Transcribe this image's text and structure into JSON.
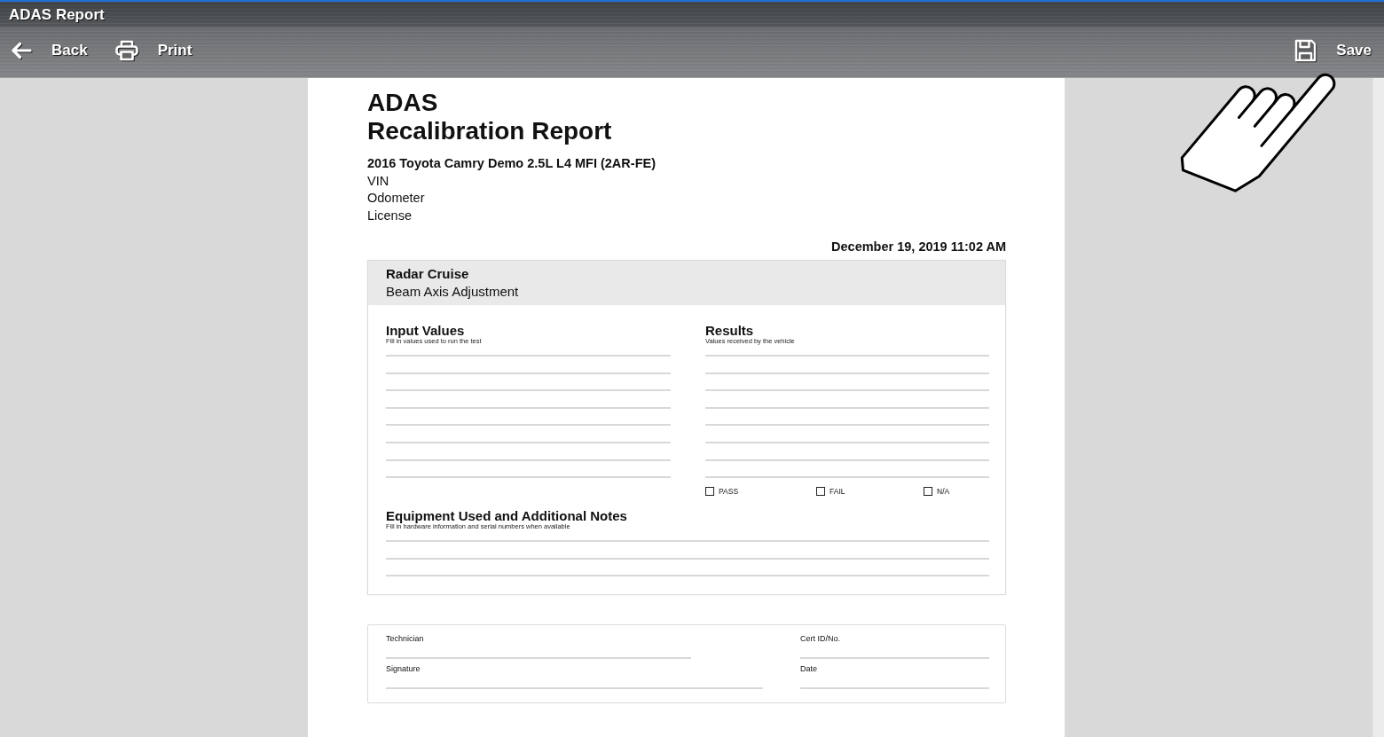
{
  "window": {
    "title": "ADAS Report"
  },
  "toolbar": {
    "left_actions": [
      {
        "kind": "back",
        "label": "Back"
      },
      {
        "kind": "print",
        "label": "Print"
      }
    ],
    "right_actions": [
      {
        "kind": "save",
        "label": "Save"
      }
    ]
  },
  "report": {
    "title_lines": [
      "ADAS",
      "Recalibration Report"
    ],
    "vehicle": "2016 Toyota Camry Demo 2.5L L4 MFI (2AR-FE)",
    "details": [
      "VIN",
      "Odometer",
      "License"
    ],
    "date": "December 19, 2019 11:02 AM",
    "procedure": {
      "system": "Radar Cruise",
      "operation": "Beam Axis Adjustment"
    },
    "input_values": {
      "heading": "Input Values",
      "hint": "Fill in values used to run the test"
    },
    "results": {
      "heading": "Results",
      "hint": "Values received by the vehicle",
      "outcomes": [
        {
          "label": "PASS",
          "checked": false
        },
        {
          "label": "FAIL",
          "checked": false
        },
        {
          "label": "N/A",
          "checked": false
        }
      ]
    },
    "notes": {
      "heading": "Equipment Used and Additional Notes",
      "hint": "Fill in hardware information and serial numbers when available"
    },
    "signoff": [
      {
        "label": "Technician"
      },
      {
        "label": "Cert ID/No."
      },
      {
        "label": "Signature"
      },
      {
        "label": "Date"
      }
    ]
  }
}
